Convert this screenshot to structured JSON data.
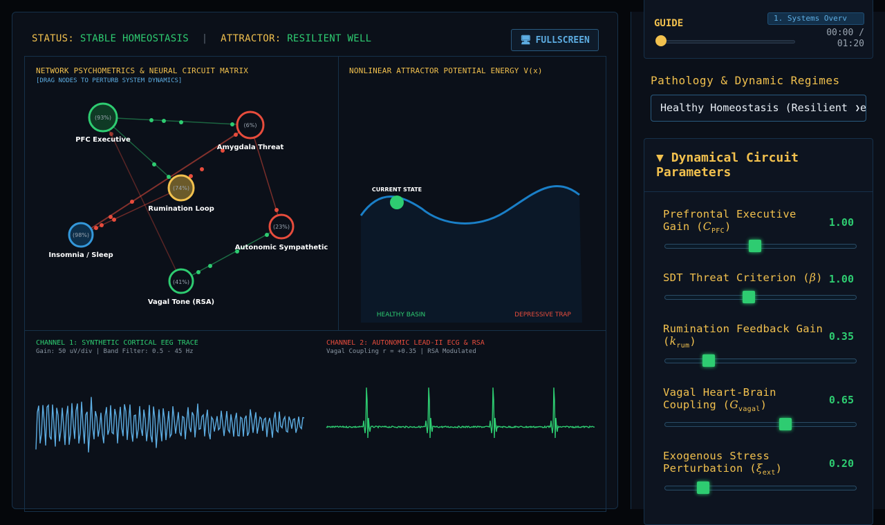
{
  "status": {
    "status_label": "STATUS:",
    "status_value": "STABLE HOMEOSTASIS",
    "separator": "|",
    "attractor_label": "ATTRACTOR:",
    "attractor_value": "RESILIENT WELL",
    "fullscreen_label": "FULLSCREEN"
  },
  "network": {
    "title": "NETWORK PSYCHOMETRICS & NEURAL CIRCUIT MATRIX",
    "subtitle": "[DRAG NODES TO PERTURB SYSTEM DYNAMICS]",
    "nodes": [
      {
        "label": "PFC Executive",
        "value": "(93%)",
        "color": "#2ecc71"
      },
      {
        "label": "Amygdala Threat",
        "value": "(6%)",
        "color": "#e74c3c"
      },
      {
        "label": "Rumination Loop",
        "value": "(74%)",
        "color": "#f2c14e"
      },
      {
        "label": "Insomnia / Sleep",
        "value": "(98%)",
        "color": "#3498db"
      },
      {
        "label": "Autonomic Sympathetic",
        "value": "(23%)",
        "color": "#e74c3c"
      },
      {
        "label": "Vagal Tone (RSA)",
        "value": "(41%)",
        "color": "#2ecc71"
      }
    ]
  },
  "potential": {
    "title": "NONLINEAR ATTRACTOR POTENTIAL ENERGY V(x)",
    "state_label": "CURRENT STATE",
    "left_basin": "HEALTHY BASIN",
    "right_basin": "DEPRESSIVE TRAP"
  },
  "channels": {
    "ch1_title": "CHANNEL 1: SYNTHETIC CORTICAL EEG TRACE",
    "ch1_sub": "Gain: 50 uV/div | Band Filter: 0.5 - 45 Hz",
    "ch2_title": "CHANNEL 2: AUTONOMIC LEAD-II ECG & RSA",
    "ch2_sub": "Vagal Coupling r = +0.35 | RSA Modulated"
  },
  "sidebar": {
    "guide_title": "GUIDE",
    "guide_chip": "1. Systems Overv",
    "guide_time": "00:00 /",
    "guide_total": "01:20",
    "guide_progress": 0,
    "pathology_label": "Pathology & Dynamic Regimes",
    "regime_selected": "Healthy Homeostasis (Resilient Well)",
    "params_title_1": "Dynamical Circuit",
    "params_title_2": "Parameters",
    "params": [
      {
        "label1": "Prefrontal Executive",
        "label2": "Gain (",
        "sym": "C",
        "sub": "PFC",
        "value": "1.00",
        "fraction": 0.47
      },
      {
        "label1": "SDT Threat Criterion (",
        "sym": "β",
        "value": "1.00",
        "fraction": 0.44
      },
      {
        "label1": "Rumination Feedback Gain",
        "label2": "(",
        "sym": "k",
        "sub": "rum",
        "value": "0.35",
        "fraction": 0.23
      },
      {
        "label1": "Vagal Heart-Brain",
        "label2": "Coupling (",
        "sym": "G",
        "sub": "vagal",
        "value": "0.65",
        "fraction": 0.63
      },
      {
        "label1": "Exogenous Stress",
        "label2": "Perturbation (",
        "sym": "ξ",
        "sub": "ext",
        "value": "0.20",
        "fraction": 0.2
      }
    ]
  },
  "colors": {
    "accent": "#f2c14e",
    "healthy": "#2ecc71",
    "threat": "#e74c3c",
    "info": "#5dade2"
  }
}
